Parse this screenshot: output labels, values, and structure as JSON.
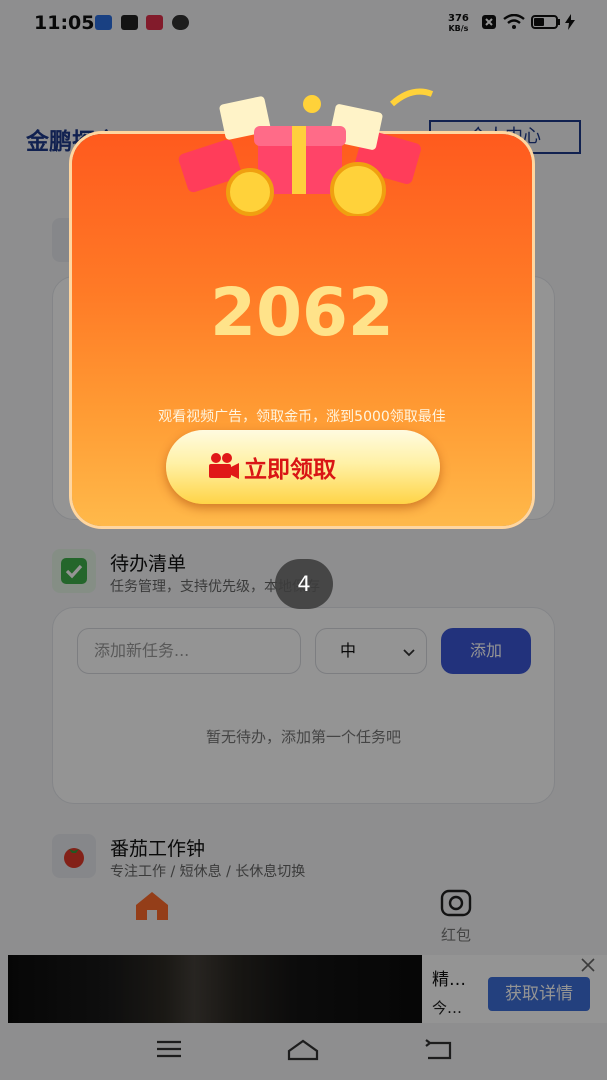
{
  "status_bar": {
    "time": "11:05",
    "net_speed": "376",
    "net_unit": "KB/s"
  },
  "header": {
    "app_title": "金鹏探方",
    "personal_center": "个人中心"
  },
  "todo_section": {
    "icon": "checkbox-icon",
    "title": "待办清单",
    "subtitle": "任务管理，支持优先级，本地保存",
    "input_placeholder": "添加新任务...",
    "priority_value": "中",
    "add_label": "添加",
    "empty_text": "暂无待办，添加第一个任务吧"
  },
  "pomodoro_section": {
    "icon": "tomato-icon",
    "title": "番茄工作钟",
    "subtitle": "专注工作 / 短休息 / 长休息切换"
  },
  "bottom_nav": {
    "home_icon": "home-icon",
    "redpacket_label": "红包"
  },
  "ad": {
    "title": "精…",
    "subtitle": "今…",
    "cta": "获取详情"
  },
  "popup": {
    "amount": "2062",
    "description": "观看视频广告，领取金币，涨到5000领取最佳",
    "claim_label": "立即领取",
    "countdown": "4"
  },
  "colors": {
    "accent": "#3b57d6",
    "popup_orange": "#ff6a22",
    "claim_text": "#d91515",
    "amount": "#ffe38a"
  }
}
